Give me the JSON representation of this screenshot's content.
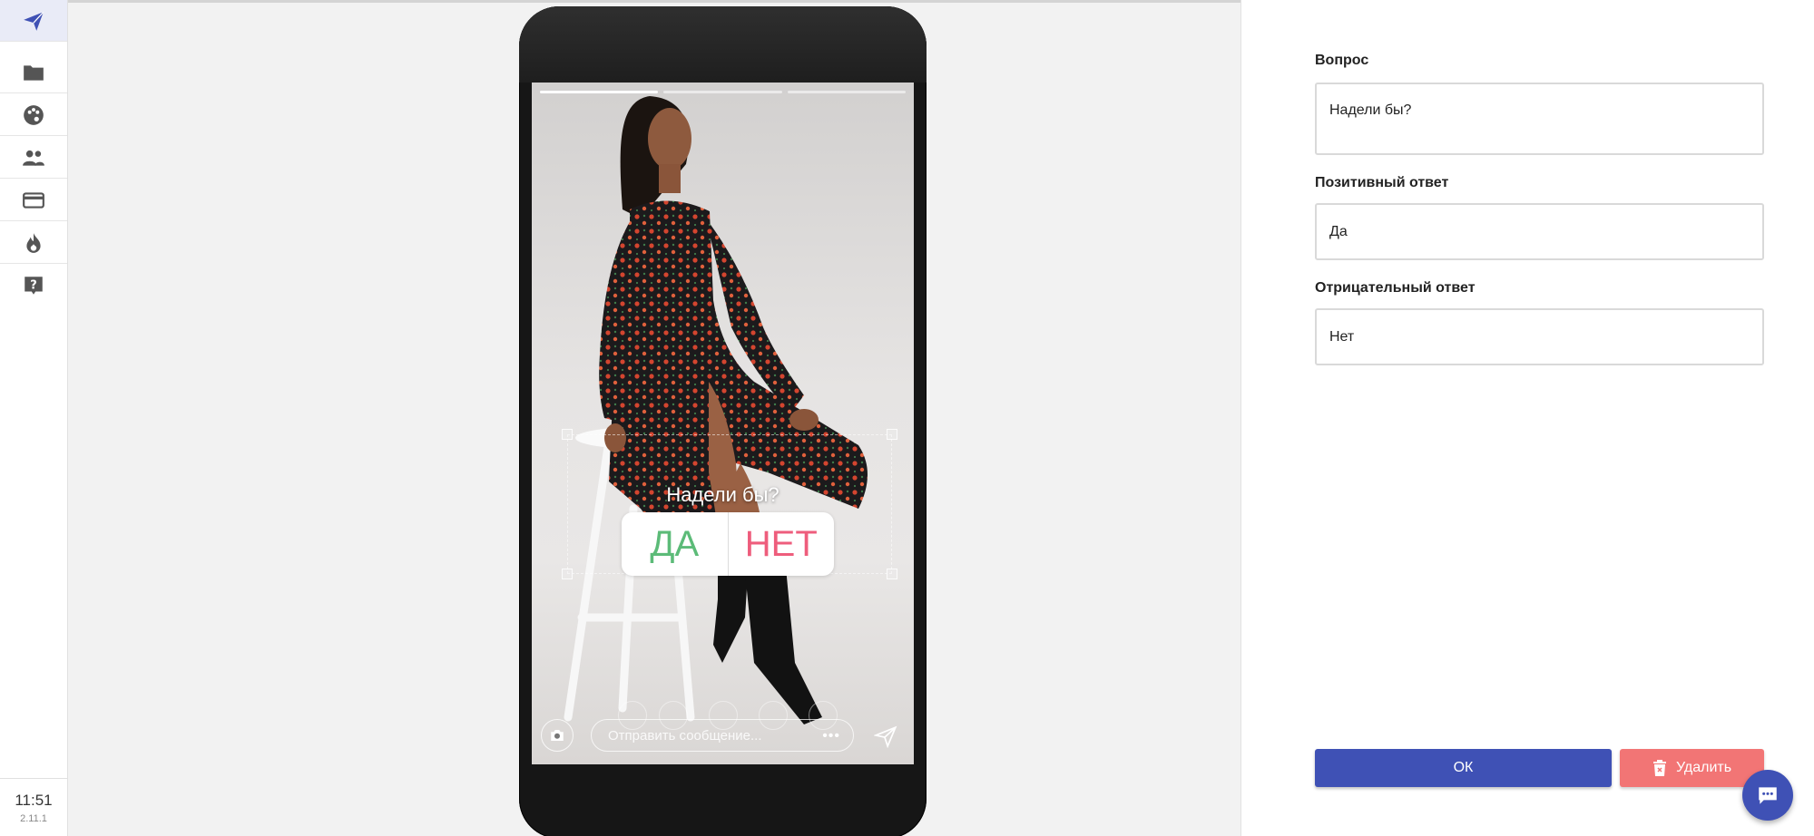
{
  "sidebar": {
    "items": [
      {
        "icon": "send-icon",
        "active": true
      },
      {
        "icon": "folder-icon",
        "active": false
      },
      {
        "icon": "palette-icon",
        "active": false
      },
      {
        "icon": "people-icon",
        "active": false
      },
      {
        "icon": "credit-card-icon",
        "active": false
      },
      {
        "icon": "fire-icon",
        "active": false
      },
      {
        "icon": "help-icon",
        "active": false
      }
    ],
    "time": "11:51",
    "version": "2.11.1"
  },
  "preview": {
    "progress_segments": 3,
    "progress_done": 1,
    "poll": {
      "question": "Надели бы?",
      "yes": "ДА",
      "no": "НЕТ",
      "yes_color": "#5cbb78",
      "no_color": "#ee5d7c"
    },
    "message_placeholder": "Отправить сообщение..."
  },
  "form": {
    "question_label": "Вопрос",
    "question_value": "Надели бы?",
    "positive_label": "Позитивный ответ",
    "positive_value": "Да",
    "negative_label": "Отрицательный ответ",
    "negative_value": "Нет"
  },
  "actions": {
    "ok_label": "ОК",
    "delete_label": "Удалить",
    "ok_color": "#3f51b5",
    "delete_color": "#f27575"
  }
}
